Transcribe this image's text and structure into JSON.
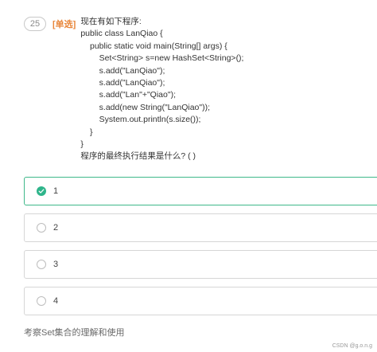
{
  "question": {
    "number": "25",
    "type_label": "[单选]",
    "lines": [
      "现在有如下程序:",
      "public class LanQiao {",
      "    public static void main(String[] args) {",
      "        Set<String> s=new HashSet<String>();",
      "        s.add(\"LanQiao\");",
      "        s.add(\"LanQiao\");",
      "        s.add(\"Lan\"+\"Qiao\");",
      "        s.add(new String(\"LanQiao\"));",
      "        System.out.println(s.size());",
      "    }",
      "}",
      "程序的最终执行结果是什么? ( )"
    ]
  },
  "options": [
    {
      "label": "1",
      "selected": true
    },
    {
      "label": "2",
      "selected": false
    },
    {
      "label": "3",
      "selected": false
    },
    {
      "label": "4",
      "selected": false
    }
  ],
  "explanation": "考察Set集合的理解和使用",
  "watermark": "CSDN @g.o.n.g",
  "colors": {
    "accent": "#2fb58b",
    "type_label": "#e8863a",
    "border": "#d6d6d6"
  },
  "icons": {
    "selected": "check-circle-icon",
    "unselected": "radio-circle-icon"
  }
}
